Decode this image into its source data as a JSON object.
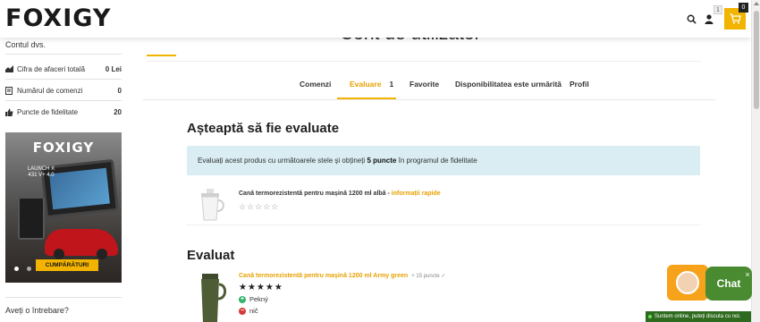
{
  "header": {
    "logo": "FOXIGY",
    "user_badge": "1",
    "cart_count": "0"
  },
  "sidebar": {
    "title": "Contul dvs.",
    "stats": [
      {
        "label": "Cifra de afaceri totală",
        "value": "0 Lei",
        "icon": "chart-icon"
      },
      {
        "label": "Numărul de comenzi",
        "value": "0",
        "icon": "receipt-icon"
      },
      {
        "label": "Puncte de fidelitate",
        "value": "20",
        "icon": "thumbs-up-icon"
      }
    ],
    "banner": {
      "logo": "FOXIGY",
      "text": "LAUNCH X 431 V+ 4.0",
      "button": "CUMPĂRĂTURI"
    },
    "ask": "Aveți o întrebare?"
  },
  "main": {
    "title": "Cont de utilizator",
    "tabs": [
      {
        "label": "Comenzi"
      },
      {
        "label": "Evaluare",
        "count": "1"
      },
      {
        "label": "Favorite"
      },
      {
        "label": "Disponibilitatea este urmărită"
      },
      {
        "label": "Profil"
      }
    ],
    "pending_title": "Așteaptă să fie evaluate",
    "info": {
      "prefix": "Evaluați acest produs cu următoarele stele și obțineți",
      "bold": "5 puncte",
      "suffix": "în programul de fidelitate"
    },
    "pending_product": {
      "name": "Cană termorezistentă pentru mașină 1200 ml albă",
      "sep": " - ",
      "link": "informații rapide",
      "stars": "☆☆☆☆☆"
    },
    "rated_title": "Evaluat",
    "rated_product": {
      "name": "Cană termorezistentă pentru mașină 1200 ml Army green",
      "points": "+ 15 puncte ✓",
      "stars": "★★★★★",
      "pro": "Pekný",
      "con": "nič"
    }
  },
  "chat": {
    "label": "Chat",
    "close": "×",
    "status": "Suntem online, puteți discuta cu noi."
  },
  "colors": {
    "accent": "#f2b400",
    "info_bg": "#d9edf2",
    "chat_green": "#4a8b32",
    "chat_orange": "#f7a21b"
  }
}
